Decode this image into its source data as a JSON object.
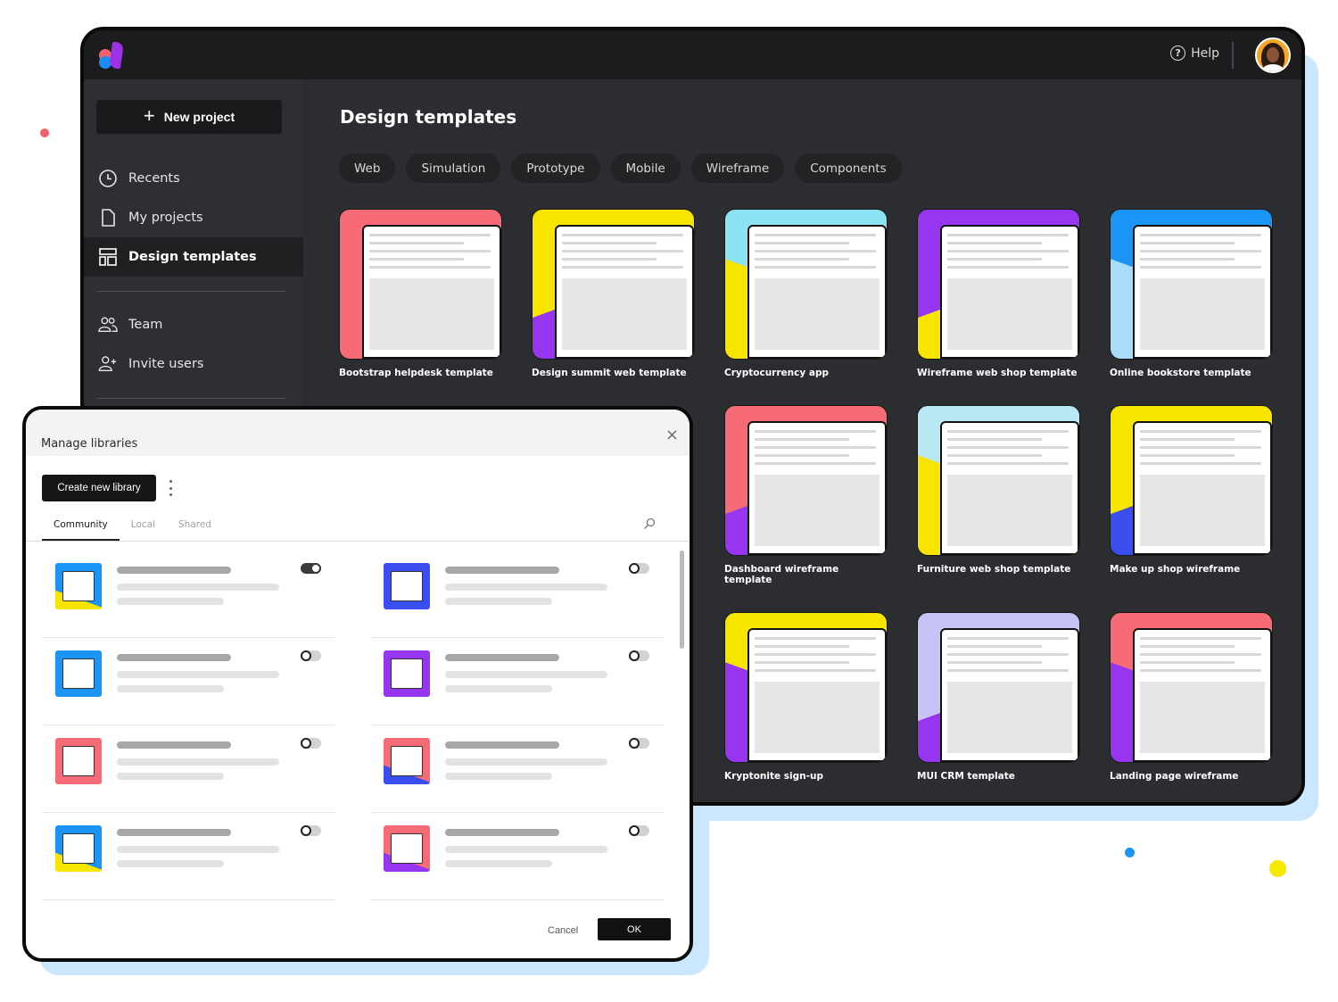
{
  "topbar": {
    "logo": "app-logo",
    "help_label": "Help",
    "help_icon": "?"
  },
  "sidebar": {
    "new_project_label": "New project",
    "items": [
      {
        "label": "Recents",
        "icon": "clock-icon",
        "active": false
      },
      {
        "label": "My projects",
        "icon": "file-icon",
        "active": false
      },
      {
        "label": "Design templates",
        "icon": "layout-icon",
        "active": true
      },
      {
        "label": "Team",
        "icon": "team-icon",
        "active": false
      },
      {
        "label": "Invite users",
        "icon": "invite-user-icon",
        "active": false
      }
    ]
  },
  "main": {
    "title": "Design templates",
    "filters": [
      "Web",
      "Simulation",
      "Prototype",
      "Mobile",
      "Wireframe",
      "Components"
    ],
    "templates": [
      {
        "label": "Bootstrap helpdesk template",
        "colors": [
          "#f76b77",
          "#f76b77"
        ]
      },
      {
        "label": "Design summit web template",
        "colors": [
          "#f7e500",
          "#9636f0"
        ]
      },
      {
        "label": "Cryptocurrency app",
        "colors": [
          "#8be3f4",
          "#f7e500"
        ]
      },
      {
        "label": "Wireframe web shop template",
        "colors": [
          "#9636f0",
          "#f7e500"
        ]
      },
      {
        "label": "Online bookstore template",
        "colors": [
          "#1a95f5",
          "#a8dcf7"
        ]
      },
      {
        "label": "Dashboard wireframe template",
        "colors": [
          "#f76b77",
          "#9636f0"
        ]
      },
      {
        "label": "Furniture web shop template",
        "colors": [
          "#b8e9f5",
          "#f7e500"
        ]
      },
      {
        "label": "Make up shop wireframe",
        "colors": [
          "#f7e500",
          "#3a4ef0"
        ]
      },
      {
        "label": "Kryptonite sign-up",
        "colors": [
          "#f7e500",
          "#9636f0"
        ]
      },
      {
        "label": "MUI CRM template",
        "colors": [
          "#c7c3f7",
          "#9636f0"
        ]
      },
      {
        "label": "Landing page wireframe",
        "colors": [
          "#f76b77",
          "#9636f0"
        ]
      }
    ]
  },
  "modal": {
    "title": "Manage libraries",
    "close_icon": "×",
    "create_label": "Create new library",
    "tabs": [
      {
        "label": "Community",
        "active": true
      },
      {
        "label": "Local",
        "active": false
      },
      {
        "label": "Shared",
        "active": false
      }
    ],
    "libraries": [
      {
        "enabled": true,
        "colors": [
          "#1a95f5",
          "#f7e500"
        ]
      },
      {
        "enabled": false,
        "colors": [
          "#3a4ef0",
          "#3a4ef0"
        ]
      },
      {
        "enabled": false,
        "colors": [
          "#1a95f5",
          "#1a95f5"
        ]
      },
      {
        "enabled": false,
        "colors": [
          "#9636f0",
          "#9636f0"
        ]
      },
      {
        "enabled": false,
        "colors": [
          "#f76b77",
          "#f76b77"
        ]
      },
      {
        "enabled": false,
        "colors": [
          "#f76b77",
          "#3a4ef0"
        ]
      },
      {
        "enabled": false,
        "colors": [
          "#1a95f5",
          "#f7e500"
        ]
      },
      {
        "enabled": false,
        "colors": [
          "#f76b77",
          "#9636f0"
        ]
      }
    ],
    "cancel_label": "Cancel",
    "ok_label": "OK"
  }
}
